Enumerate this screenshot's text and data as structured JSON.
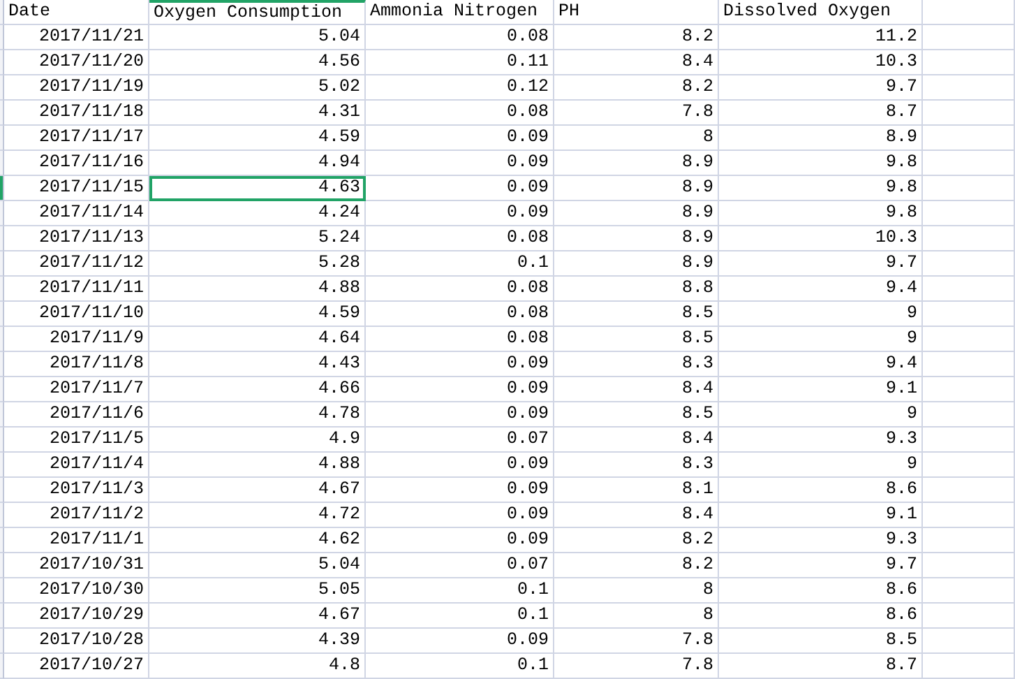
{
  "columns": [
    {
      "label": "Date",
      "selected": false
    },
    {
      "label": "Oxygen Consumption",
      "selected": true
    },
    {
      "label": "Ammonia Nitrogen",
      "selected": false
    },
    {
      "label": "PH",
      "selected": false
    },
    {
      "label": "Dissolved Oxygen",
      "selected": false
    }
  ],
  "rows": [
    {
      "cells": [
        "2017/11/21",
        "5.04",
        "0.08",
        "8.2",
        "11.2"
      ],
      "selected": false
    },
    {
      "cells": [
        "2017/11/20",
        "4.56",
        "0.11",
        "8.4",
        "10.3"
      ],
      "selected": false
    },
    {
      "cells": [
        "2017/11/19",
        "5.02",
        "0.12",
        "8.2",
        "9.7"
      ],
      "selected": false
    },
    {
      "cells": [
        "2017/11/18",
        "4.31",
        "0.08",
        "7.8",
        "8.7"
      ],
      "selected": false
    },
    {
      "cells": [
        "2017/11/17",
        "4.59",
        "0.09",
        "8",
        "8.9"
      ],
      "selected": false
    },
    {
      "cells": [
        "2017/11/16",
        "4.94",
        "0.09",
        "8.9",
        "9.8"
      ],
      "selected": false
    },
    {
      "cells": [
        "2017/11/15",
        "4.63",
        "0.09",
        "8.9",
        "9.8"
      ],
      "selected": true
    },
    {
      "cells": [
        "2017/11/14",
        "4.24",
        "0.09",
        "8.9",
        "9.8"
      ],
      "selected": false
    },
    {
      "cells": [
        "2017/11/13",
        "5.24",
        "0.08",
        "8.9",
        "10.3"
      ],
      "selected": false
    },
    {
      "cells": [
        "2017/11/12",
        "5.28",
        "0.1",
        "8.9",
        "9.7"
      ],
      "selected": false
    },
    {
      "cells": [
        "2017/11/11",
        "4.88",
        "0.08",
        "8.8",
        "9.4"
      ],
      "selected": false
    },
    {
      "cells": [
        "2017/11/10",
        "4.59",
        "0.08",
        "8.5",
        "9"
      ],
      "selected": false
    },
    {
      "cells": [
        "2017/11/9",
        "4.64",
        "0.08",
        "8.5",
        "9"
      ],
      "selected": false
    },
    {
      "cells": [
        "2017/11/8",
        "4.43",
        "0.09",
        "8.3",
        "9.4"
      ],
      "selected": false
    },
    {
      "cells": [
        "2017/11/7",
        "4.66",
        "0.09",
        "8.4",
        "9.1"
      ],
      "selected": false
    },
    {
      "cells": [
        "2017/11/6",
        "4.78",
        "0.09",
        "8.5",
        "9"
      ],
      "selected": false
    },
    {
      "cells": [
        "2017/11/5",
        "4.9",
        "0.07",
        "8.4",
        "9.3"
      ],
      "selected": false
    },
    {
      "cells": [
        "2017/11/4",
        "4.88",
        "0.09",
        "8.3",
        "9"
      ],
      "selected": false
    },
    {
      "cells": [
        "2017/11/3",
        "4.67",
        "0.09",
        "8.1",
        "8.6"
      ],
      "selected": false
    },
    {
      "cells": [
        "2017/11/2",
        "4.72",
        "0.09",
        "8.4",
        "9.1"
      ],
      "selected": false
    },
    {
      "cells": [
        "2017/11/1",
        "4.62",
        "0.09",
        "8.2",
        "9.3"
      ],
      "selected": false
    },
    {
      "cells": [
        "2017/10/31",
        "5.04",
        "0.07",
        "8.2",
        "9.7"
      ],
      "selected": false
    },
    {
      "cells": [
        "2017/10/30",
        "5.05",
        "0.1",
        "8",
        "8.6"
      ],
      "selected": false
    },
    {
      "cells": [
        "2017/10/29",
        "4.67",
        "0.1",
        "8",
        "8.6"
      ],
      "selected": false
    },
    {
      "cells": [
        "2017/10/28",
        "4.39",
        "0.09",
        "7.8",
        "8.5"
      ],
      "selected": false
    },
    {
      "cells": [
        "2017/10/27",
        "4.8",
        "0.1",
        "7.8",
        "8.7"
      ],
      "selected": false
    }
  ]
}
